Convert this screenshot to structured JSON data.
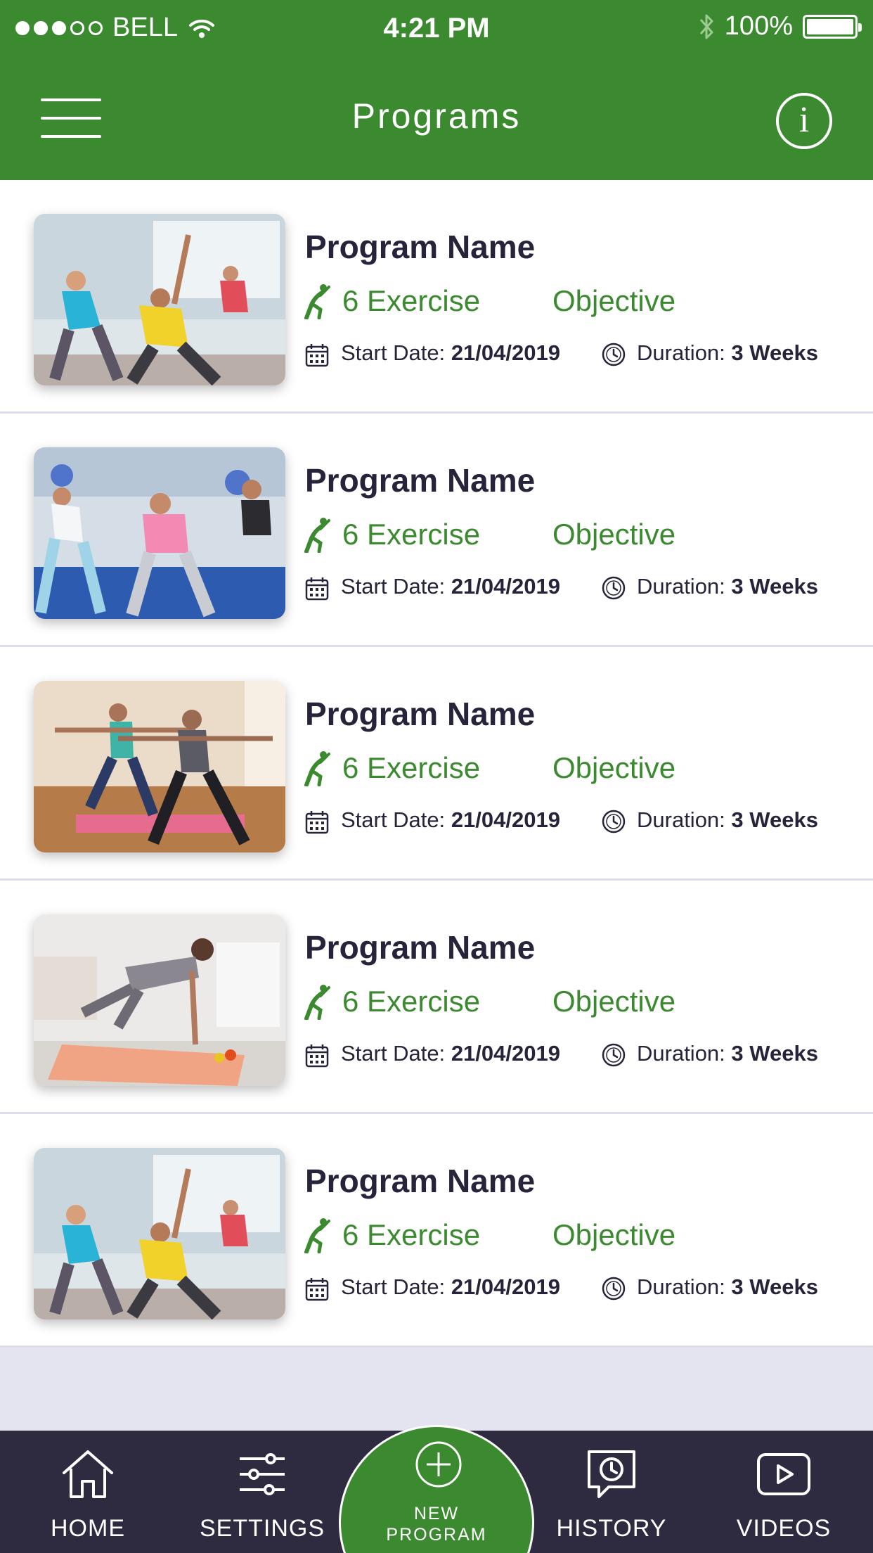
{
  "status_bar": {
    "carrier": "BELL",
    "time": "4:21 PM",
    "battery": "100%",
    "signal_bars_filled": 3,
    "signal_bars_total": 5
  },
  "header": {
    "title": "Programs",
    "menu_icon": "hamburger-menu-icon",
    "info_icon": "info-icon"
  },
  "programs": [
    {
      "name": "Program Name",
      "exercise": "6 Exercise",
      "objective": "Objective",
      "start_label": "Start Date:",
      "start_date": "21/04/2019",
      "duration_label": "Duration:",
      "duration": "3 Weeks",
      "image": "yoga-class-photo"
    },
    {
      "name": "Program Name",
      "exercise": "6 Exercise",
      "objective": "Objective",
      "start_label": "Start Date:",
      "start_date": "21/04/2019",
      "duration_label": "Duration:",
      "duration": "3 Weeks",
      "image": "fitness-class-photo"
    },
    {
      "name": "Program Name",
      "exercise": "6 Exercise",
      "objective": "Objective",
      "start_label": "Start Date:",
      "start_date": "21/04/2019",
      "duration_label": "Duration:",
      "duration": "3 Weeks",
      "image": "warrior-pose-photo"
    },
    {
      "name": "Program Name",
      "exercise": "6 Exercise",
      "objective": "Objective",
      "start_label": "Start Date:",
      "start_date": "21/04/2019",
      "duration_label": "Duration:",
      "duration": "3 Weeks",
      "image": "home-workout-photo"
    },
    {
      "name": "Program Name",
      "exercise": "6 Exercise",
      "objective": "Objective",
      "start_label": "Start Date:",
      "start_date": "21/04/2019",
      "duration_label": "Duration:",
      "duration": "3 Weeks",
      "image": "yoga-class-photo"
    }
  ],
  "tabbar": {
    "home": "HOME",
    "settings": "SETTINGS",
    "new_program_line1": "NEW",
    "new_program_line2": "PROGRAM",
    "history": "HISTORY",
    "videos": "VIDEOS"
  },
  "colors": {
    "brand_green": "#3b8a2f",
    "tabbar_dark": "#2e2b40",
    "text_dark": "#27233a",
    "background": "#e4e4f0"
  }
}
